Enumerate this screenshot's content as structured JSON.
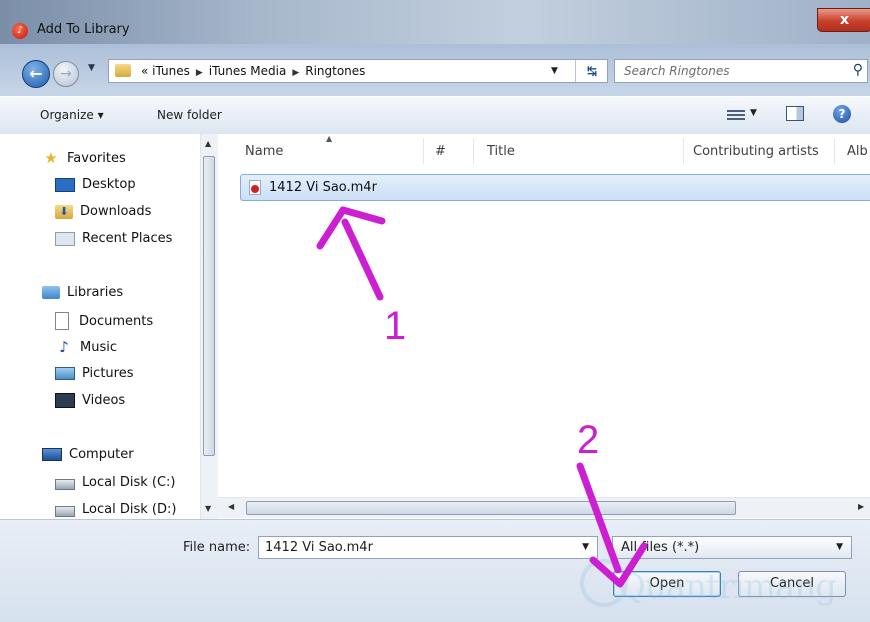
{
  "window": {
    "title": "Add To Library",
    "close_label": "x"
  },
  "address": {
    "breadcrumbs": [
      "« iTunes",
      "iTunes Media",
      "Ringtones"
    ]
  },
  "search": {
    "placeholder": "Search Ringtones"
  },
  "toolbar": {
    "organize_label": "Organize ▾",
    "new_folder_label": "New folder"
  },
  "sidebar": {
    "favorites": {
      "label": "Favorites",
      "items": [
        {
          "label": "Desktop"
        },
        {
          "label": "Downloads"
        },
        {
          "label": "Recent Places"
        }
      ]
    },
    "libraries": {
      "label": "Libraries",
      "items": [
        {
          "label": "Documents"
        },
        {
          "label": "Music"
        },
        {
          "label": "Pictures"
        },
        {
          "label": "Videos"
        }
      ]
    },
    "computer": {
      "label": "Computer",
      "items": [
        {
          "label": "Local Disk (C:)"
        },
        {
          "label": "Local Disk (D:)"
        }
      ]
    }
  },
  "columns": [
    "Name",
    "#",
    "Title",
    "Contributing artists",
    "Alb"
  ],
  "files": [
    {
      "name": "1412 Vi Sao.m4r"
    }
  ],
  "footer": {
    "file_name_label": "File name:",
    "file_name_value": "1412 Vi Sao.m4r",
    "file_type_value": "All files (*.*)",
    "open_label": "Open",
    "cancel_label": "Cancel"
  },
  "annotations": {
    "step1": "1",
    "step2": "2"
  },
  "watermark": {
    "text": "Quantrimang"
  },
  "colors": {
    "annotation": "#cc1fd1",
    "selection": "#cbdff6",
    "titlebar": "#a7b8cc"
  },
  "icons": [
    "back-arrow-icon",
    "forward-arrow-icon",
    "folder-icon",
    "refresh-icon",
    "search-icon",
    "views-icon",
    "preview-pane-icon",
    "help-icon",
    "star-icon",
    "desktop-icon",
    "downloads-icon",
    "recent-places-icon",
    "library-icon",
    "documents-icon",
    "music-icon",
    "pictures-icon",
    "videos-icon",
    "computer-icon",
    "disk-icon",
    "audio-file-icon"
  ]
}
